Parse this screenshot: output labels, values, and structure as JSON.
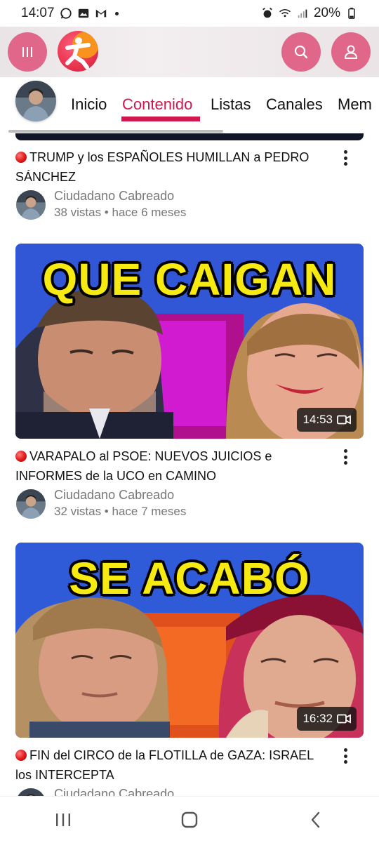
{
  "status_bar": {
    "time": "14:07",
    "battery": "20%",
    "left_icons": [
      "whatsapp-icon",
      "gallery-icon",
      "gmail-icon",
      "dot-icon"
    ],
    "right_icons": [
      "alarm-icon",
      "wifi-calling-icon",
      "signal-icon",
      "battery-icon"
    ]
  },
  "header": {
    "menu_icon": "menu-icon",
    "logo": "app-logo",
    "search_icon": "search-icon",
    "profile_icon": "profile-icon",
    "accent_color": "#e0668a"
  },
  "tabs": [
    {
      "label": "Inicio",
      "active": false
    },
    {
      "label": "Contenido",
      "active": true
    },
    {
      "label": "Listas",
      "active": false
    },
    {
      "label": "Canales",
      "active": false
    },
    {
      "label": "Mem",
      "active": false
    }
  ],
  "videos": [
    {
      "title": "TRUMP y los ESPAÑOLES HUMILLAN a PEDRO SÁNCHEZ",
      "channel": "Ciudadano Cabreado",
      "stats": "38 vistas • hace 6 meses"
    },
    {
      "thumbnail_text": "QUE CAIGAN",
      "duration": "14:53",
      "title": "VARAPALO al PSOE:  NUEVOS JUICIOS e INFORMES de la UCO en CAMINO",
      "channel": "Ciudadano Cabreado",
      "stats": "32 vistas • hace 7 meses"
    },
    {
      "thumbnail_text": "SE ACABÓ",
      "duration": "16:32",
      "title": "FIN del CIRCO de la FLOTILLA de GAZA:  ISRAEL los INTERCEPTA",
      "channel": "Ciudadano Cabreado"
    }
  ],
  "colors": {
    "active_tab": "#d0184f",
    "title_text": "#111111",
    "meta_text": "#777777",
    "thumb_text": "#f6ea12"
  },
  "nav_bar": [
    "recents-icon",
    "home-icon",
    "back-icon"
  ]
}
